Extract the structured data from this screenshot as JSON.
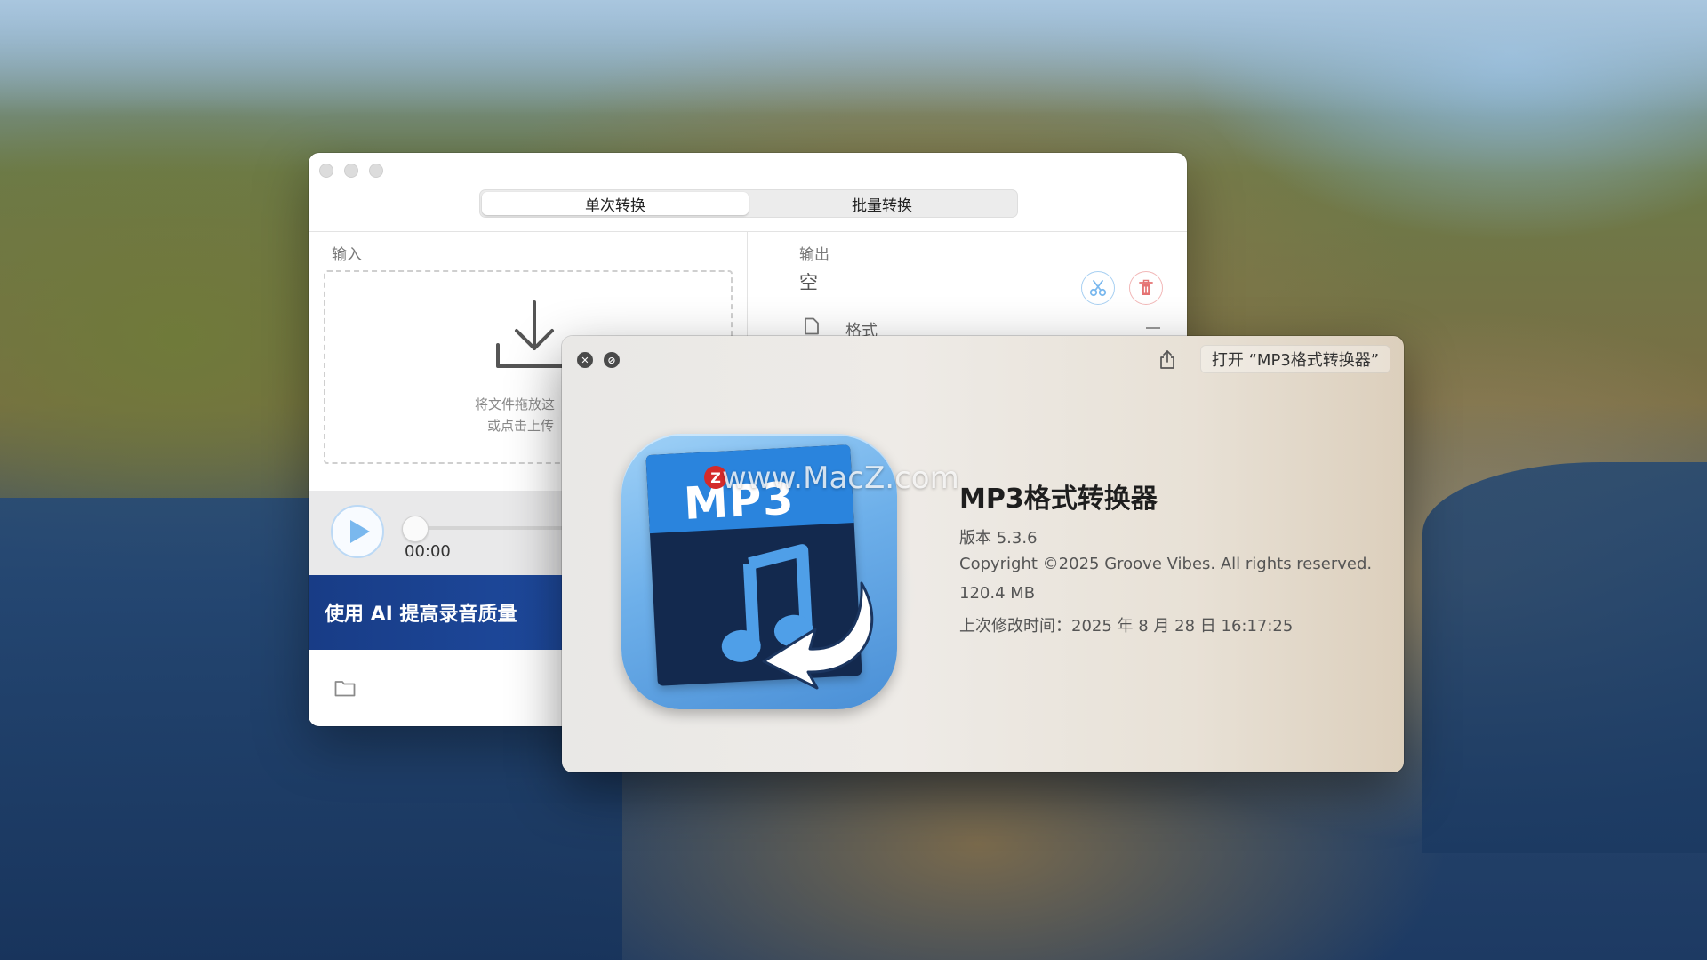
{
  "main_window": {
    "tabs": [
      {
        "label": "单次转换",
        "active": true
      },
      {
        "label": "批量转换",
        "active": false
      }
    ],
    "input": {
      "label": "输入",
      "drop_text_line1": "将文件拖放这",
      "drop_text_line2": "或点击上传",
      "drop_icon": "download-icon"
    },
    "player": {
      "time": "00:00",
      "play_icon": "play-icon"
    },
    "banner": {
      "text": "使用 AI 提高录音质量"
    },
    "output": {
      "label": "输出",
      "value": "空",
      "format_label": "格式",
      "cut_icon": "scissors-icon",
      "delete_icon": "trash-icon"
    }
  },
  "about_window": {
    "open_button": "打开 “MP3格式转换器”",
    "app_name": "MP3格式转换器",
    "version": "版本 5.3.6",
    "copyright": "Copyright ©2025 Groove Vibes. All rights reserved.",
    "size": "120.4 MB",
    "modified": "上次修改时间：2025 年 8 月 28 日 16:17:25",
    "icon_text": "MP3",
    "watermark": "www.MacZ.com",
    "watermark_badge": "Z"
  },
  "colors": {
    "accent_blue": "#7ab8ee",
    "delete_red": "#e57373",
    "banner_blue": "#1e4a9e"
  }
}
